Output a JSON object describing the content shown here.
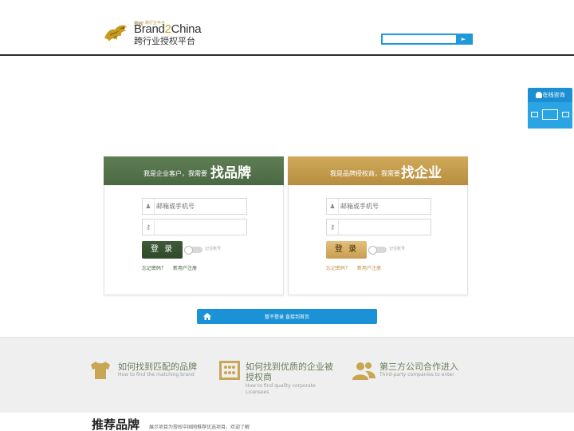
{
  "colors": {
    "green": "#4a6842",
    "gold": "#c99d4e",
    "blue": "#1a92d5"
  },
  "header": {
    "logo_small": "授权",
    "logo_small2": "跨行业平台",
    "logo_brand_pre": "Brand",
    "logo_brand_num": "2",
    "logo_brand_post": "China",
    "logo_sub": "跨行业授权平台",
    "search_placeholder": "",
    "search_icon": "arrow-right-icon"
  },
  "widget": {
    "title": "在线咨询"
  },
  "left_box": {
    "small": "我是企业客户，我需要",
    "big": "找品牌",
    "username_placeholder": "邮箱或手机号",
    "password_placeholder": "",
    "login": "登 录",
    "remember": "记住账号",
    "forgot": "忘记密码？",
    "register": "新用户注册"
  },
  "right_box": {
    "small": "我是品牌授权商，我需要",
    "big": "找企业",
    "username_placeholder": "邮箱或手机号",
    "password_placeholder": "",
    "login": "登 录",
    "remember": "记住账号",
    "forgot": "忘记密码？",
    "register": "新用户注册"
  },
  "home_bar": {
    "text": "暂不登录 直接到首页"
  },
  "info": [
    {
      "cn": "如何找到匹配的品牌",
      "en": "How to find the matching brand"
    },
    {
      "cn": "如何找到优质的企业被授权商",
      "en": "How to find quality corporate Licensees"
    },
    {
      "cn": "第三方公司合作进入",
      "en": "Third-party companies to enter"
    }
  ],
  "recommend": {
    "title": "推荐品牌",
    "desc": "展示项目为授权中国网推荐优选项目，欢迎了解"
  }
}
